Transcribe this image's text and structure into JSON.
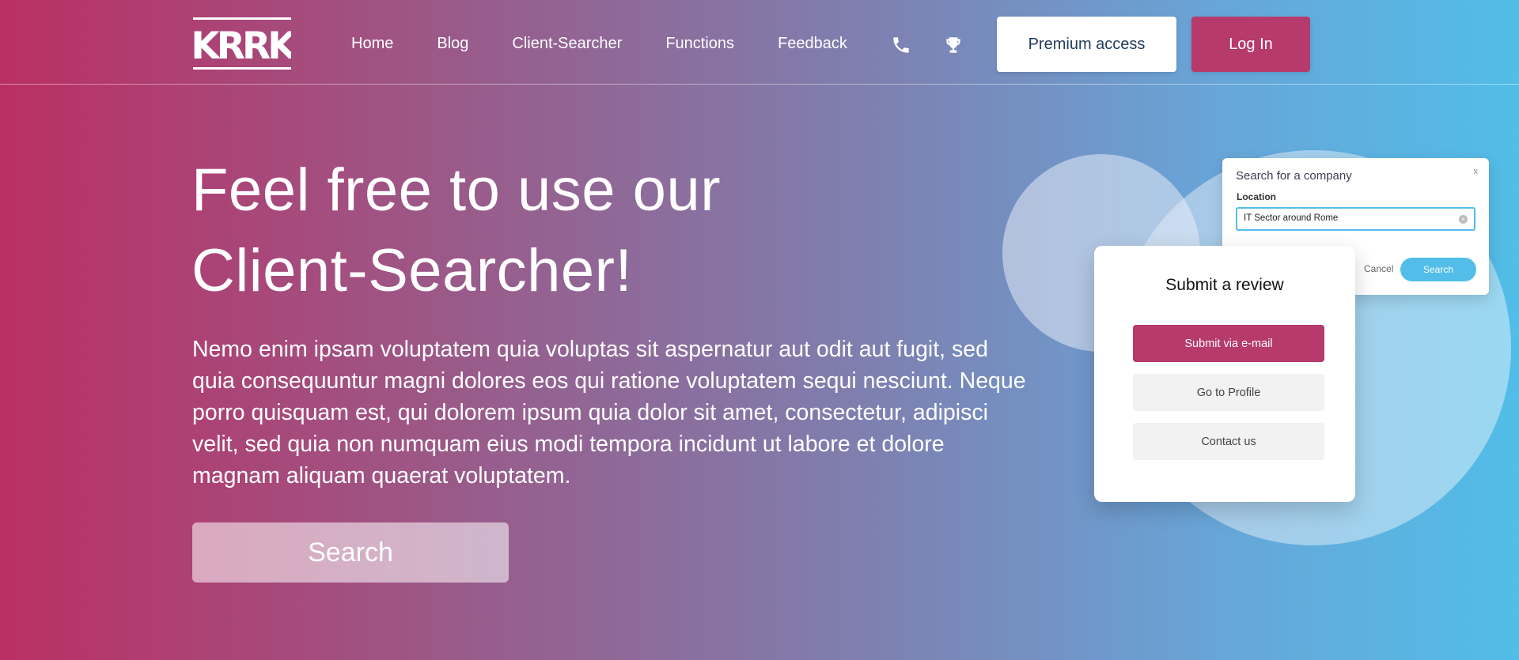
{
  "header": {
    "logo_text": "KRRK",
    "nav": [
      {
        "label": "Home"
      },
      {
        "label": "Blog"
      },
      {
        "label": "Client-Searcher"
      },
      {
        "label": "Functions"
      },
      {
        "label": "Feedback"
      }
    ],
    "icons": [
      "phone-icon",
      "trophy-icon"
    ],
    "premium_label": "Premium access",
    "login_label": "Log In"
  },
  "hero": {
    "title_line1": "Feel free to use our",
    "title_line2": "Client-Searcher!",
    "text": "Nemo enim ipsam voluptatem quia voluptas sit aspernatur aut odit aut fugit, sed quia consequuntur magni dolores eos qui ratione voluptatem sequi nesciunt. Neque porro quisquam est, qui dolorem ipsum quia dolor sit amet, consectetur, adipisci velit, sed quia non numquam eius modi tempora incidunt ut labore et dolore magnam aliquam quaerat voluptatem.",
    "search_label": "Search"
  },
  "search_dialog": {
    "title": "Search for a company",
    "close": "x",
    "location_label": "Location",
    "location_value": "IT Sector around Rome",
    "cancel_label": "Cancel",
    "search_label": "Search"
  },
  "review_card": {
    "heading": "Submit a review",
    "email_label": "Submit via e-mail",
    "profile_label": "Go to Profile",
    "contact_label": "Contact us"
  },
  "colors": {
    "gradient_start": "#bb2f64",
    "gradient_end": "#52bde8",
    "accent_pink": "#b63a6c",
    "accent_blue": "#52bde8"
  }
}
